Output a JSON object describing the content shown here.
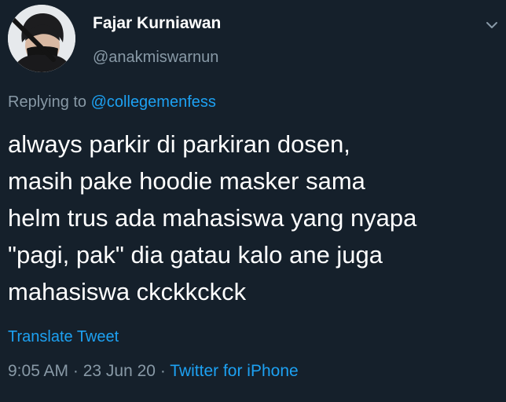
{
  "tweet": {
    "display_name": "Fajar Kurniawan",
    "username": "@anakmiswarnun",
    "replying_prefix": "Replying to ",
    "replying_mention": "@collegemenfess",
    "text": "always parkir di parkiran dosen,\nmasih pake hoodie masker sama\nhelm trus ada mahasiswa yang nyapa\n\"pagi, pak\" dia gatau kalo ane juga\nmahasiswa ckckkckck",
    "translate_label": "Translate Tweet",
    "time": "9:05 AM",
    "separator1": " · ",
    "date": "23 Jun 20",
    "separator2": " · ",
    "source": "Twitter for iPhone"
  },
  "icons": {
    "menu": "chevron-down-icon",
    "avatar": "avatar"
  },
  "colors": {
    "background": "#15202b",
    "primary_text": "#ffffff",
    "secondary_text": "#8899a6",
    "accent": "#1da1f2"
  }
}
